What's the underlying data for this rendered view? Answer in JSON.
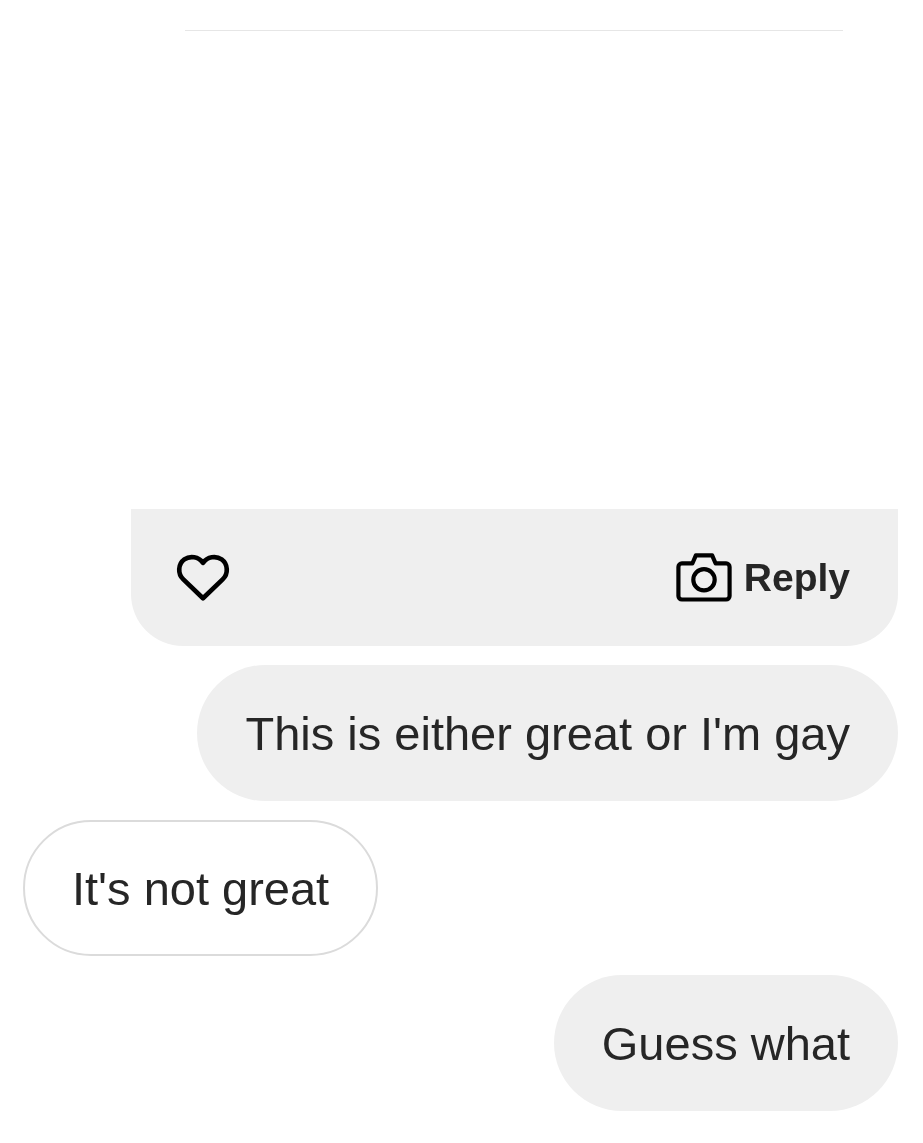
{
  "post": {
    "liked": false
  },
  "reply_button": {
    "label": "Reply"
  },
  "messages": [
    {
      "kind": "sent",
      "text": "This is either great or I'm gay"
    },
    {
      "kind": "received",
      "text": "It's not great"
    },
    {
      "kind": "sent",
      "text": "Guess what"
    }
  ]
}
